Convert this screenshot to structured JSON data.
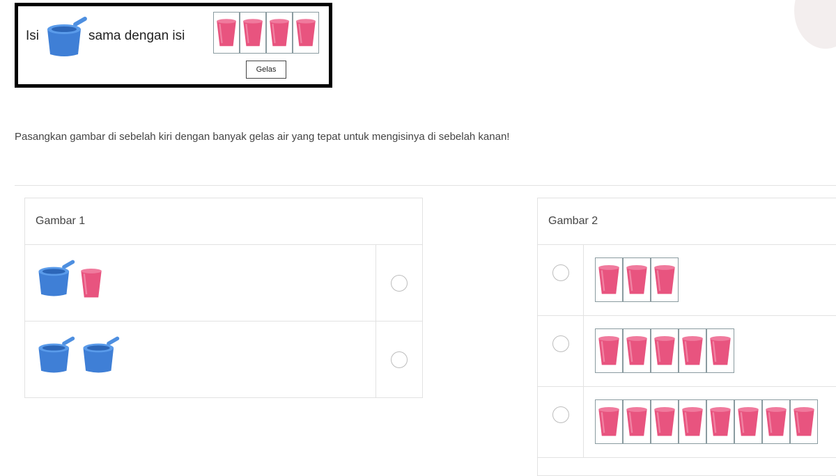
{
  "example": {
    "isi_left": "Isi",
    "middle_text": "sama dengan isi",
    "cup_count": 4,
    "unit_label": "Gelas"
  },
  "instruction": "Pasangkan gambar di sebelah kiri dengan banyak gelas air yang tepat untuk mengisinya di sebelah kanan!",
  "left_panel": {
    "title": "Gambar 1",
    "rows": [
      {
        "dippers": 1,
        "cups": 1
      },
      {
        "dippers": 2,
        "cups": 0
      }
    ]
  },
  "right_panel": {
    "title": "Gambar 2",
    "rows": [
      {
        "cups": 3
      },
      {
        "cups": 5
      },
      {
        "cups": 8
      }
    ]
  },
  "colors": {
    "dipper_blue": "#3f7fd6",
    "cup_pink": "#e8547f",
    "border_gray": "#e2e2e2"
  },
  "icons": [
    "water-dipper-icon",
    "pink-cup-icon",
    "radio-button"
  ]
}
